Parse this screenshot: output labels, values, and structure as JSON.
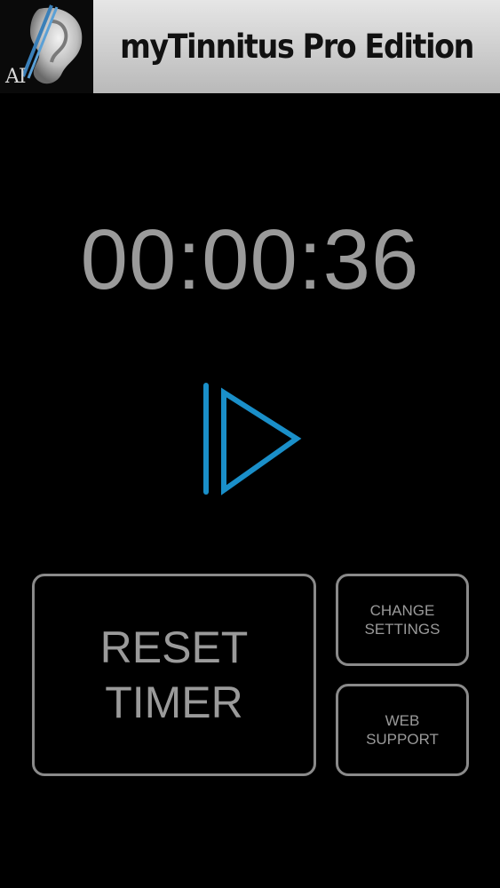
{
  "header": {
    "logo_text": "AI",
    "title": "myTinnitus Pro Edition"
  },
  "timer": {
    "display": "00:00:36"
  },
  "controls": {
    "play_icon": "play-pause-icon",
    "accent_color": "#1a8fc9"
  },
  "buttons": {
    "reset": {
      "line1": "RESET",
      "line2": "TIMER"
    },
    "settings": {
      "line1": "CHANGE",
      "line2": "SETTINGS"
    },
    "web": {
      "line1": "WEB",
      "line2": "SUPPORT"
    }
  }
}
